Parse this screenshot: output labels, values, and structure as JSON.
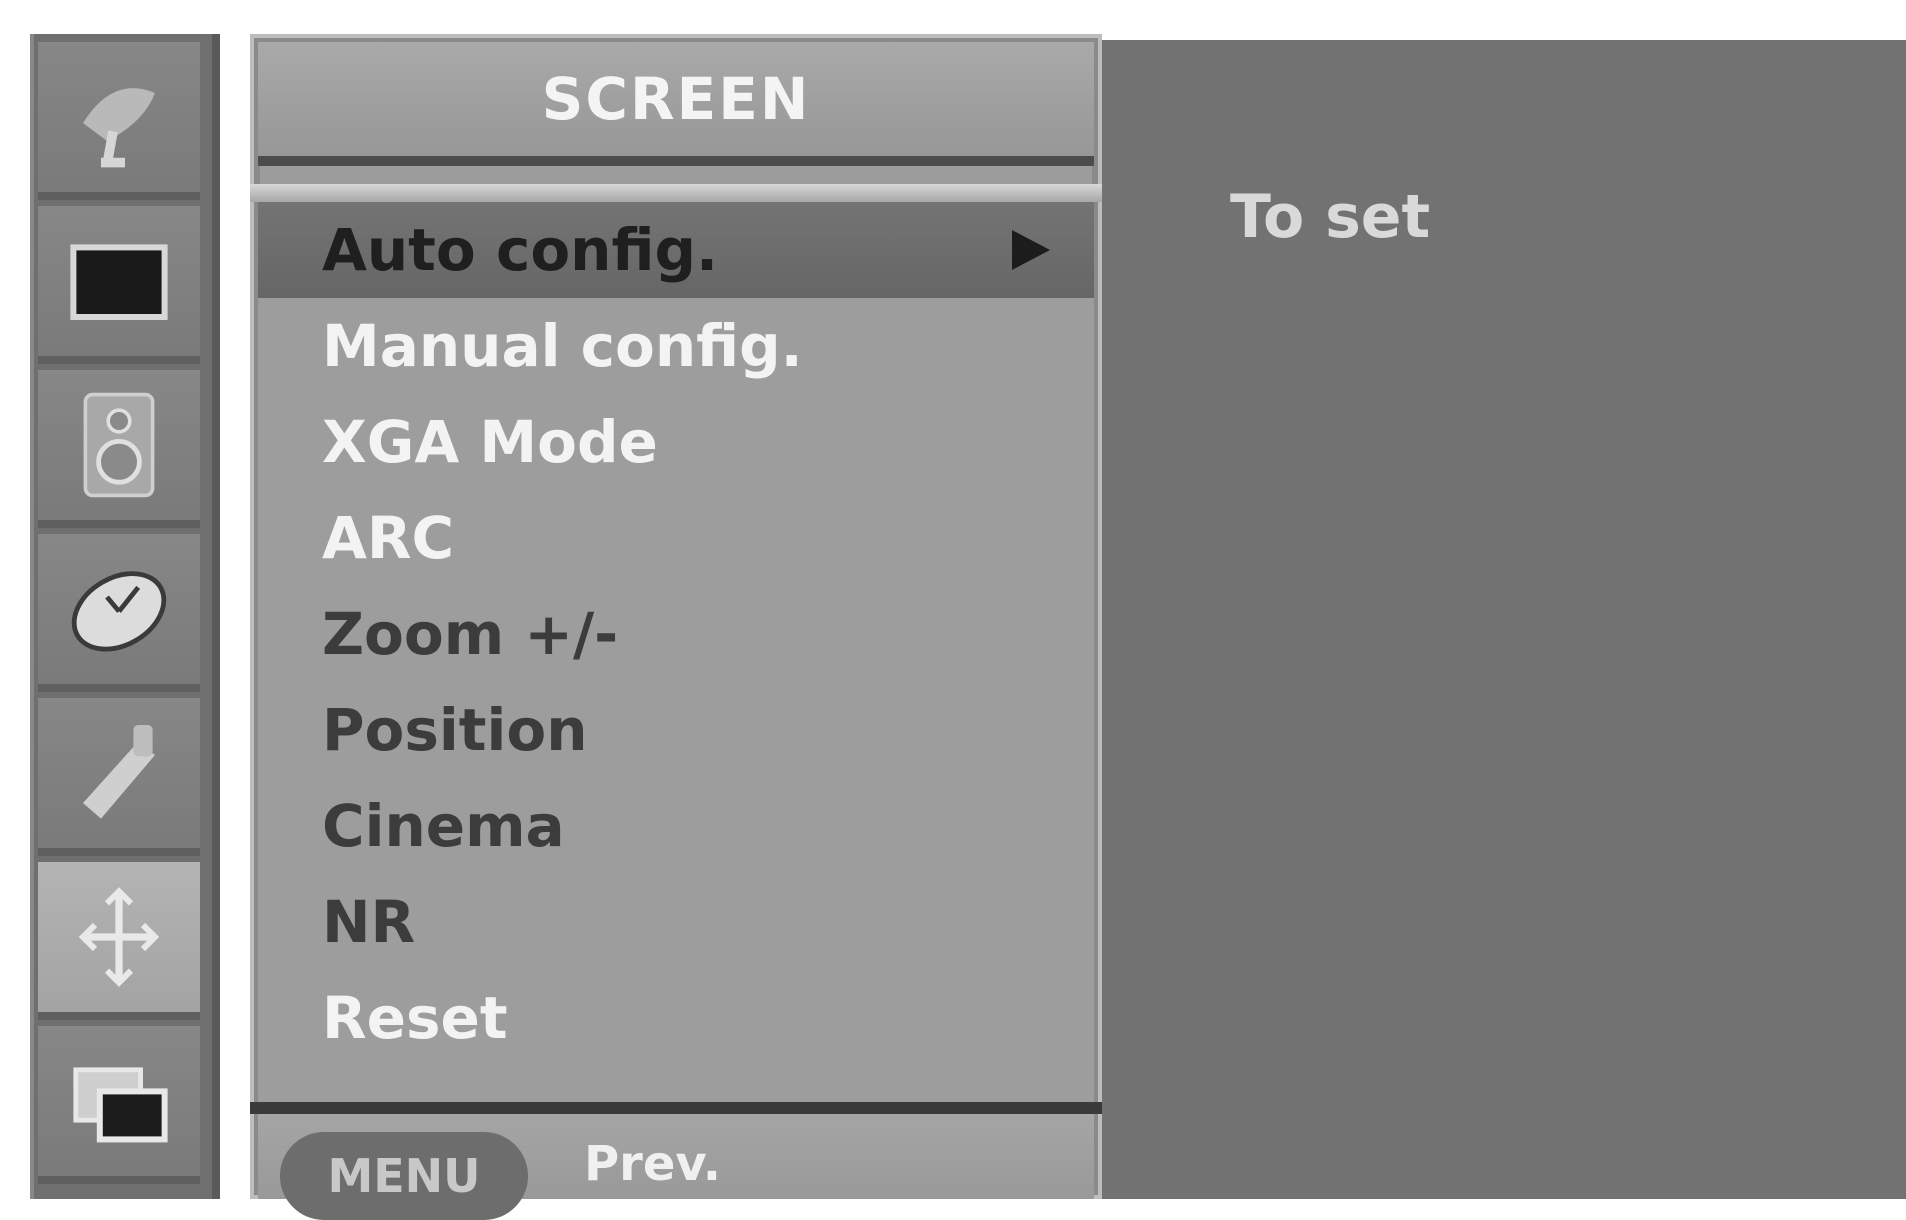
{
  "sidebar": {
    "icons": [
      {
        "name": "satellite-dish-icon"
      },
      {
        "name": "picture-icon"
      },
      {
        "name": "speaker-icon"
      },
      {
        "name": "clock-icon"
      },
      {
        "name": "special-tool-icon"
      },
      {
        "name": "screen-adjust-icon",
        "active": true
      },
      {
        "name": "pip-icon"
      }
    ]
  },
  "menu": {
    "title": "SCREEN",
    "items": [
      {
        "label": "Auto config.",
        "selected": true
      },
      {
        "label": "Manual config."
      },
      {
        "label": "XGA Mode"
      },
      {
        "label": "ARC"
      },
      {
        "label": "Zoom +/-",
        "dim": true
      },
      {
        "label": "Position",
        "dim": true
      },
      {
        "label": "Cinema",
        "dim": true
      },
      {
        "label": "NR",
        "dim": true
      },
      {
        "label": "Reset"
      }
    ],
    "footer": {
      "menu_button": "MENU",
      "prev_label": "Prev."
    }
  },
  "description": {
    "text": "To set"
  },
  "colors": {
    "panel": "#9c9c9c",
    "selected_row": "#6e6e6e",
    "description_bg": "#727272"
  }
}
